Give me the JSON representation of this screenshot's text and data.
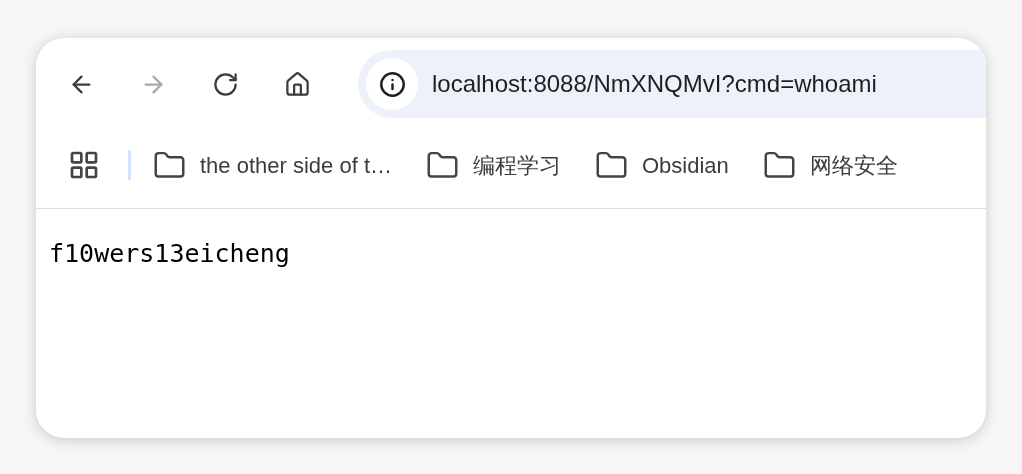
{
  "toolbar": {
    "nav_buttons": [
      {
        "kind": "back",
        "disabled": false
      },
      {
        "kind": "forward",
        "disabled": true
      },
      {
        "kind": "reload",
        "disabled": false
      },
      {
        "kind": "home",
        "disabled": false
      }
    ],
    "address": "localhost:8088/NmXNQMvI?cmd=whoami"
  },
  "bookmarks": [
    {
      "label": "the other side of t…"
    },
    {
      "label": "编程学习"
    },
    {
      "label": "Obsidian"
    },
    {
      "label": "网络安全"
    }
  ],
  "page": {
    "text": "f10wers13eicheng"
  }
}
